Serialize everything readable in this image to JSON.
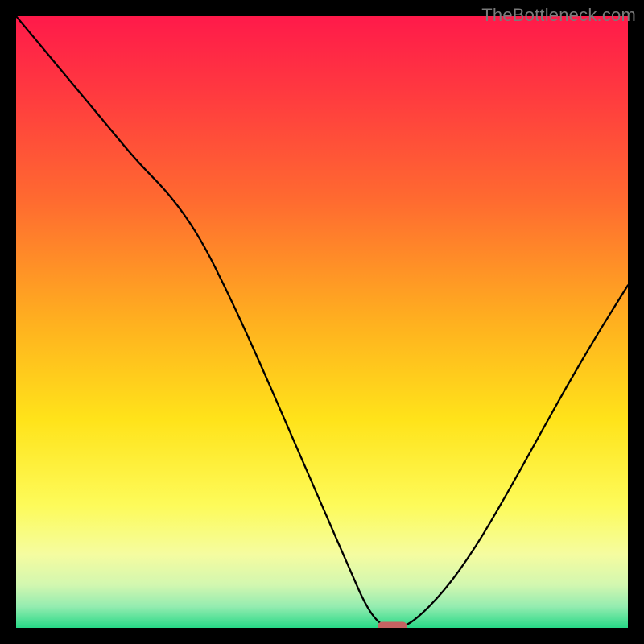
{
  "watermark": "TheBottleneck.com",
  "chart_data": {
    "type": "line",
    "title": "",
    "xlabel": "",
    "ylabel": "",
    "xlim": [
      0,
      100
    ],
    "ylim": [
      0,
      100
    ],
    "grid": false,
    "legend": false,
    "x": [
      0,
      5,
      10,
      15,
      20,
      25,
      30,
      35,
      40,
      45,
      50,
      55,
      57,
      59,
      61,
      62.5,
      65,
      70,
      75,
      80,
      85,
      90,
      95,
      100
    ],
    "values": [
      100,
      94,
      88,
      82,
      76,
      71,
      64,
      54,
      43,
      31.5,
      20,
      8.5,
      4,
      1,
      0,
      0,
      1,
      6,
      13,
      21.5,
      30.5,
      39.5,
      48,
      56
    ],
    "series": [
      {
        "name": "bottleneck-curve",
        "x": [
          0,
          5,
          10,
          15,
          20,
          25,
          30,
          35,
          40,
          45,
          50,
          55,
          57,
          59,
          61,
          62.5,
          65,
          70,
          75,
          80,
          85,
          90,
          95,
          100
        ],
        "values": [
          100,
          94,
          88,
          82,
          76,
          71,
          64,
          54,
          43,
          31.5,
          20,
          8.5,
          4,
          1,
          0,
          0,
          1,
          6,
          13,
          21.5,
          30.5,
          39.5,
          48,
          56
        ]
      }
    ],
    "marker": {
      "x": 61.5,
      "y": 0,
      "color": "#c56262"
    },
    "gradient_stops": [
      {
        "offset": 0.0,
        "color": "#ff1a4a"
      },
      {
        "offset": 0.12,
        "color": "#ff3840"
      },
      {
        "offset": 0.3,
        "color": "#ff6a30"
      },
      {
        "offset": 0.5,
        "color": "#ffb01f"
      },
      {
        "offset": 0.66,
        "color": "#ffe31a"
      },
      {
        "offset": 0.8,
        "color": "#fdfb5a"
      },
      {
        "offset": 0.88,
        "color": "#f5fca0"
      },
      {
        "offset": 0.93,
        "color": "#d2f7b0"
      },
      {
        "offset": 0.965,
        "color": "#94ecb0"
      },
      {
        "offset": 1.0,
        "color": "#28d987"
      }
    ]
  }
}
